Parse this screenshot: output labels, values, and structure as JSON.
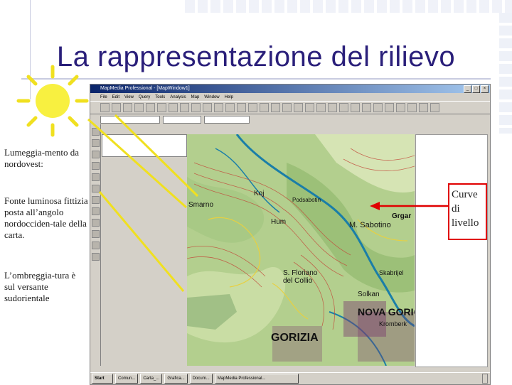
{
  "slide": {
    "title": "La rappresentazione del rilievo"
  },
  "notes": {
    "lighting": "Lumeggia-mento da nordovest:",
    "source": "Fonte luminosa fittizia posta all’angolo nordocciden-tale della carta.",
    "shading": "L’ombreggia-tura è sul versante sudorientale"
  },
  "callout": {
    "label": "Curve di livello"
  },
  "app": {
    "title": "MapMedia Professional - [MapWindow1]",
    "menu": [
      "File",
      "Edit",
      "View",
      "Query",
      "Tools",
      "Analysis",
      "Map",
      "Window",
      "Help"
    ],
    "layer_combo": "",
    "list_item": "",
    "taskbar": {
      "start": "Start",
      "buttons": [
        "Comun...",
        "Carta_...",
        "Grafica...",
        "Docum...",
        "MapMedia Professional..."
      ],
      "clock": ""
    }
  },
  "map_labels": {
    "smarno": "Smarno",
    "koj": "Koj",
    "podsabotin": "Podsabotin",
    "hum": "Hum",
    "m_sabotino": "M. Sabotino",
    "grgar": "Grgar",
    "s_floriano": "S. Floriano del Collio",
    "solkan": "Solkan",
    "nova_gorica": "NOVA GORICA",
    "gorizia": "GORIZIA",
    "kromberk": "Kromberk",
    "skabrijel": "Skabrijel"
  },
  "colors": {
    "title": "#2a1f7a",
    "arrow": "#e00000",
    "light_rays": "#f0e020",
    "sun": "#f8f040",
    "map_base": "#b3cf8e",
    "contour": "#c24a3a",
    "river": "#1a7ea8"
  }
}
